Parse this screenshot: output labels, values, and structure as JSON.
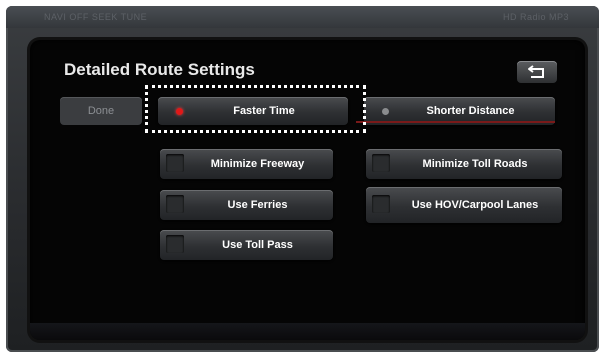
{
  "bezel": {
    "left_text": "NAVI OFF  SEEK  TUNE",
    "right_text": "HD Radio  MP3"
  },
  "screen": {
    "title": "Detailed Route Settings",
    "done_label": "Done",
    "route_options": [
      {
        "label": "Faster Time",
        "selected": true
      },
      {
        "label": "Shorter Distance",
        "selected": false
      }
    ],
    "avoid_options": [
      {
        "label": "Minimize Freeway"
      },
      {
        "label": "Minimize Toll Roads"
      },
      {
        "label": "Use Ferries"
      },
      {
        "label": "Use HOV/Carpool Lanes"
      },
      {
        "label": "Use Toll Pass"
      }
    ],
    "icons": {
      "back": "back-arrow-icon",
      "radio_selected": "radio-selected-icon",
      "radio_unselected": "radio-unselected-icon",
      "checkbox": "checkbox-icon"
    },
    "colors": {
      "selected_indicator": "#e01818",
      "unselected_indicator": "#8a8c8e",
      "accent_divider": "#7a1a1a"
    }
  }
}
